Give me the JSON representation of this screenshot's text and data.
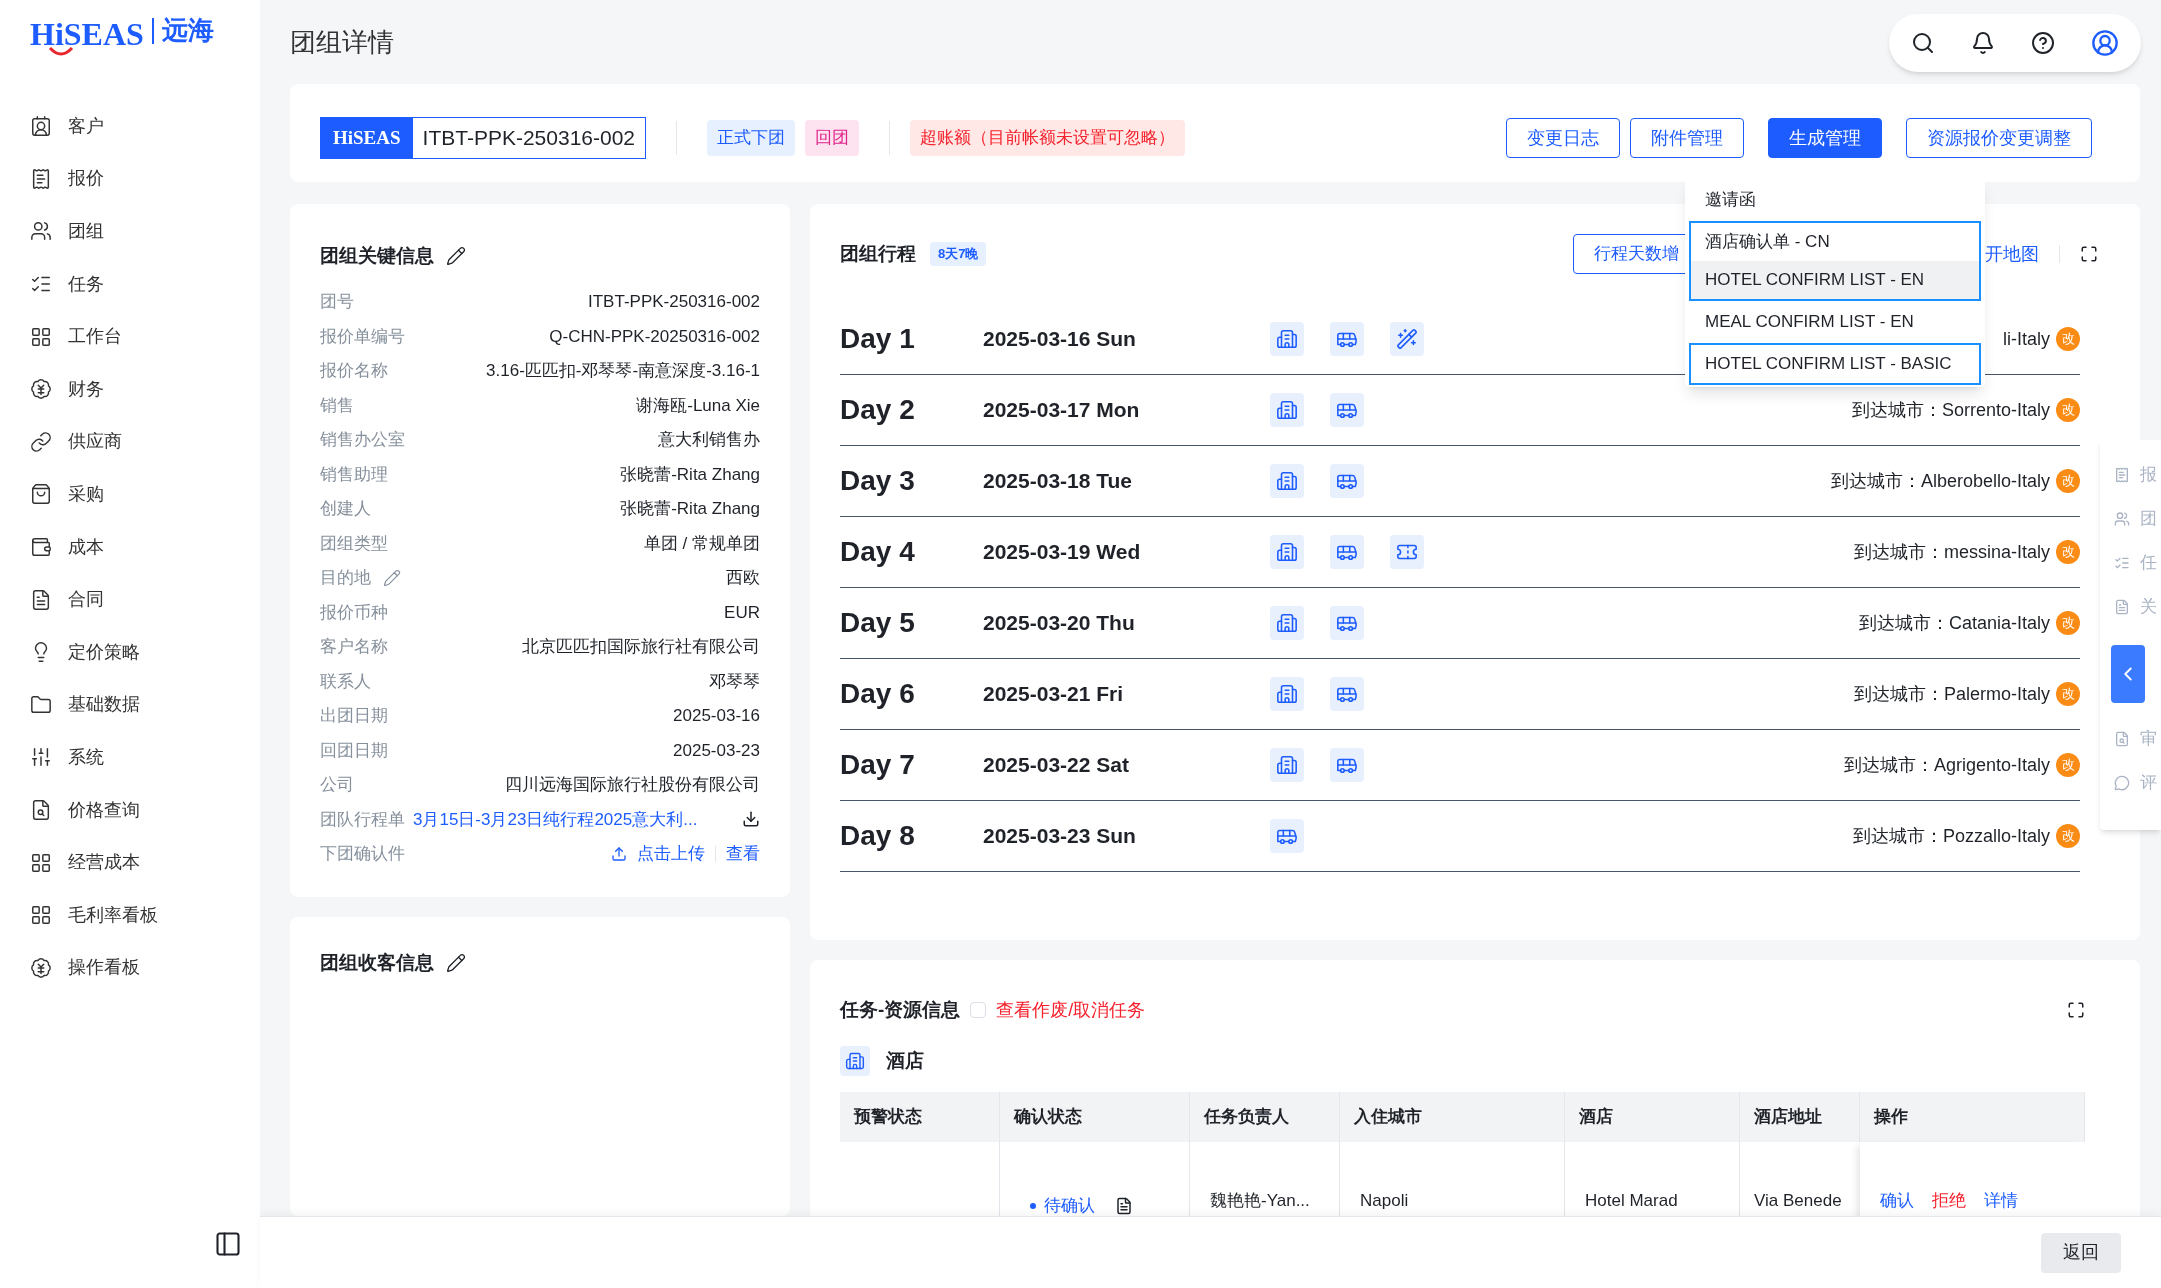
{
  "logo": {
    "brand": "HiSEAS",
    "name": "远海"
  },
  "sidebar": {
    "items": [
      {
        "label": "客户"
      },
      {
        "label": "报价"
      },
      {
        "label": "团组"
      },
      {
        "label": "任务"
      },
      {
        "label": "工作台"
      },
      {
        "label": "财务"
      },
      {
        "label": "供应商"
      },
      {
        "label": "采购"
      },
      {
        "label": "成本"
      },
      {
        "label": "合同"
      },
      {
        "label": "定价策略"
      },
      {
        "label": "基础数据"
      },
      {
        "label": "系统"
      },
      {
        "label": "价格查询"
      },
      {
        "label": "经营成本"
      },
      {
        "label": "毛利率看板"
      },
      {
        "label": "操作看板"
      }
    ]
  },
  "page_title": "团组详情",
  "header": {
    "badge_brand": "HiSEAS",
    "group_no": "ITBT-PPK-250316-002",
    "tags": [
      {
        "label": "正式下团",
        "kind": "info"
      },
      {
        "label": "回团",
        "kind": "pink"
      },
      {
        "label": "超账额（目前帐额未设置可忽略）",
        "kind": "danger"
      }
    ],
    "buttons": [
      {
        "label": "变更日志",
        "primary": false
      },
      {
        "label": "附件管理",
        "primary": false
      },
      {
        "label": "生成管理",
        "primary": true
      },
      {
        "label": "资源报价变更调整",
        "primary": false
      }
    ]
  },
  "dropdown": {
    "items": [
      {
        "label": "邀请函",
        "highlighted": false,
        "outlined": false
      },
      {
        "label": "酒店确认单 - CN",
        "highlighted": false,
        "outlined": true
      },
      {
        "label": "HOTEL CONFIRM LIST - EN",
        "highlighted": true,
        "outlined": true
      },
      {
        "label": "MEAL CONFIRM LIST - EN",
        "highlighted": false,
        "outlined": false
      },
      {
        "label": "HOTEL CONFIRM LIST - BASIC",
        "highlighted": false,
        "outlined": true
      }
    ]
  },
  "key_info": {
    "title": "团组关键信息",
    "rows": [
      {
        "label": "团号",
        "value": "ITBT-PPK-250316-002",
        "editable": false
      },
      {
        "label": "报价单编号",
        "value": "Q-CHN-PPK-20250316-002",
        "editable": false
      },
      {
        "label": "报价名称",
        "value": "3.16-匹匹扣-邓琴琴-南意深度-3.16-1",
        "editable": false
      },
      {
        "label": "销售",
        "value": "谢海瓯-Luna Xie",
        "editable": false
      },
      {
        "label": "销售办公室",
        "value": "意大利销售办",
        "editable": false
      },
      {
        "label": "销售助理",
        "value": "张晓蕾-Rita Zhang",
        "editable": false
      },
      {
        "label": "创建人",
        "value": "张晓蕾-Rita Zhang",
        "editable": false
      },
      {
        "label": "团组类型",
        "value": "单团 / 常规单团",
        "editable": false
      },
      {
        "label": "目的地",
        "value": "西欧",
        "editable": true
      },
      {
        "label": "报价币种",
        "value": "EUR",
        "editable": false
      },
      {
        "label": "客户名称",
        "value": "北京匹匹扣国际旅行社有限公司",
        "editable": false
      },
      {
        "label": "联系人",
        "value": "邓琴琴",
        "editable": false
      },
      {
        "label": "出团日期",
        "value": "2025-03-16",
        "editable": false
      },
      {
        "label": "回团日期",
        "value": "2025-03-23",
        "editable": false
      },
      {
        "label": "公司",
        "value": "四川远海国际旅行社股份有限公司",
        "editable": false
      }
    ],
    "itinerary_file": {
      "label": "团队行程单",
      "value": "3月15日-3月23日纯行程2025意大利..."
    },
    "confirm_file": {
      "label": "下团确认件",
      "upload": "点击上传",
      "view": "查看"
    }
  },
  "guest_info": {
    "title": "团组收客信息"
  },
  "itinerary": {
    "title": "团组行程",
    "badge": "8天7晚",
    "add_button": "行程天数增",
    "map_link": "开地图",
    "days": [
      {
        "day": "Day 1",
        "date": "2025-03-16 Sun",
        "services": [
          {
            "kind": "hotel"
          },
          {
            "kind": "bus"
          },
          {
            "kind": "activity"
          }
        ],
        "city": "li-Italy",
        "edit": "改"
      },
      {
        "day": "Day 2",
        "date": "2025-03-17 Mon",
        "services": [
          {
            "kind": "hotel"
          },
          {
            "kind": "bus"
          }
        ],
        "city": "到达城市：Sorrento-Italy",
        "edit": "改"
      },
      {
        "day": "Day 3",
        "date": "2025-03-18 Tue",
        "services": [
          {
            "kind": "hotel"
          },
          {
            "kind": "bus"
          }
        ],
        "city": "到达城市：Alberobello-Italy",
        "edit": "改"
      },
      {
        "day": "Day 4",
        "date": "2025-03-19 Wed",
        "services": [
          {
            "kind": "hotel"
          },
          {
            "kind": "bus"
          },
          {
            "kind": "ticket"
          }
        ],
        "city": "到达城市：messina-Italy",
        "edit": "改"
      },
      {
        "day": "Day 5",
        "date": "2025-03-20 Thu",
        "services": [
          {
            "kind": "hotel"
          },
          {
            "kind": "bus"
          }
        ],
        "city": "到达城市：Catania-Italy",
        "edit": "改"
      },
      {
        "day": "Day 6",
        "date": "2025-03-21 Fri",
        "services": [
          {
            "kind": "hotel"
          },
          {
            "kind": "bus"
          }
        ],
        "city": "到达城市：Palermo-Italy",
        "edit": "改"
      },
      {
        "day": "Day 7",
        "date": "2025-03-22 Sat",
        "services": [
          {
            "kind": "hotel"
          },
          {
            "kind": "bus"
          }
        ],
        "city": "到达城市：Agrigento-Italy",
        "edit": "改"
      },
      {
        "day": "Day 8",
        "date": "2025-03-23 Sun",
        "services": [
          {
            "kind": "bus"
          }
        ],
        "city": "到达城市：Pozzallo-Italy",
        "edit": "改"
      }
    ]
  },
  "tasks": {
    "title": "任务-资源信息",
    "show_cancelled": {
      "label": "查看作废/取消任务",
      "checked": false
    },
    "section": "酒店",
    "columns": [
      "预警状态",
      "确认状态",
      "任务负责人",
      "入住城市",
      "酒店",
      "酒店地址",
      "操作"
    ],
    "rows": [
      {
        "status": "待确认",
        "owner": "魏艳艳-Yan...",
        "city": "Napoli",
        "hotel": "Hotel Marad",
        "address": "Via Benede",
        "actions": [
          {
            "label": "确认",
            "kind": "normal"
          },
          {
            "label": "拒绝",
            "kind": "danger"
          },
          {
            "label": "详情",
            "kind": "normal"
          }
        ]
      }
    ]
  },
  "side_panel": {
    "items": [
      {
        "label": "报"
      },
      {
        "label": "团"
      },
      {
        "label": "任"
      },
      {
        "label": "关"
      },
      {
        "label": "审"
      },
      {
        "label": "评"
      }
    ]
  },
  "footer": {
    "back": "返回"
  }
}
